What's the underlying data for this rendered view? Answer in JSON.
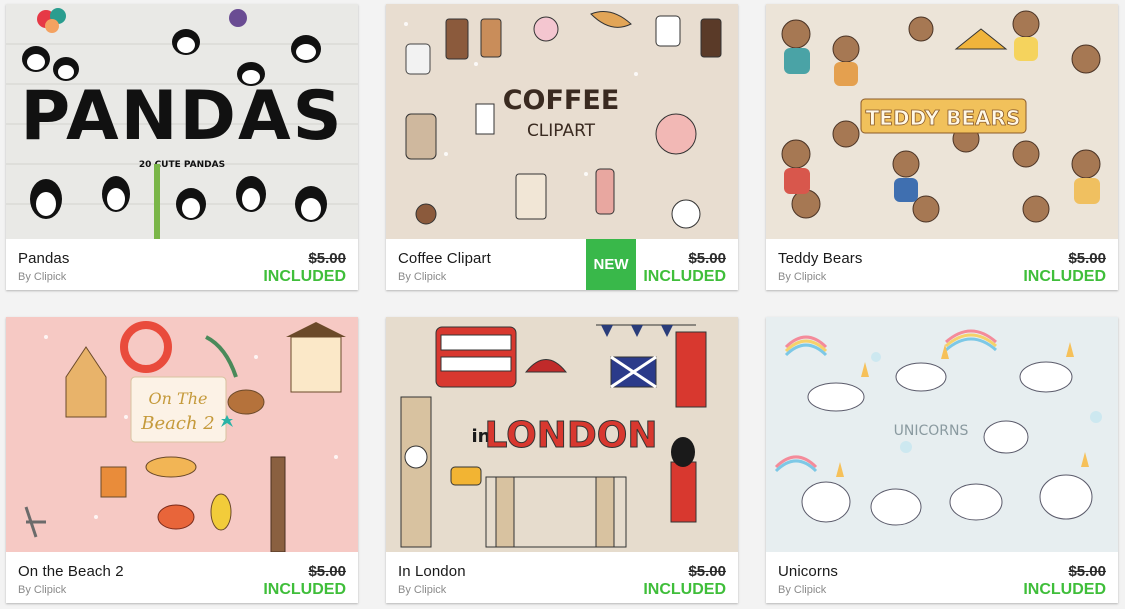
{
  "products": [
    {
      "title": "Pandas",
      "byline": "By Clipick",
      "price": "$5.00",
      "status": "INCLUDED",
      "badge": "",
      "art_text": "PANDAS",
      "art_sub": "20 CUTE PANDAS"
    },
    {
      "title": "Coffee Clipart",
      "byline": "By Clipick",
      "price": "$5.00",
      "status": "INCLUDED",
      "badge": "NEW",
      "art_text": "COFFEE",
      "art_sub": "CLIPART"
    },
    {
      "title": "Teddy Bears",
      "byline": "By Clipick",
      "price": "$5.00",
      "status": "INCLUDED",
      "badge": "",
      "art_text": "TEDDY BEARS",
      "art_sub": ""
    },
    {
      "title": "On the Beach 2",
      "byline": "By Clipick",
      "price": "$5.00",
      "status": "INCLUDED",
      "badge": "",
      "art_text": "On The",
      "art_sub": "Beach 2"
    },
    {
      "title": "In London",
      "byline": "By Clipick",
      "price": "$5.00",
      "status": "INCLUDED",
      "badge": "",
      "art_text": "LONDON",
      "art_sub": "in"
    },
    {
      "title": "Unicorns",
      "byline": "By Clipick",
      "price": "$5.00",
      "status": "INCLUDED",
      "badge": "",
      "art_text": "UNICORNS",
      "art_sub": ""
    }
  ],
  "colors": {
    "included": "#3fbe3a",
    "new_badge": "#39b84a",
    "page_bg": "#f3f3f3"
  }
}
